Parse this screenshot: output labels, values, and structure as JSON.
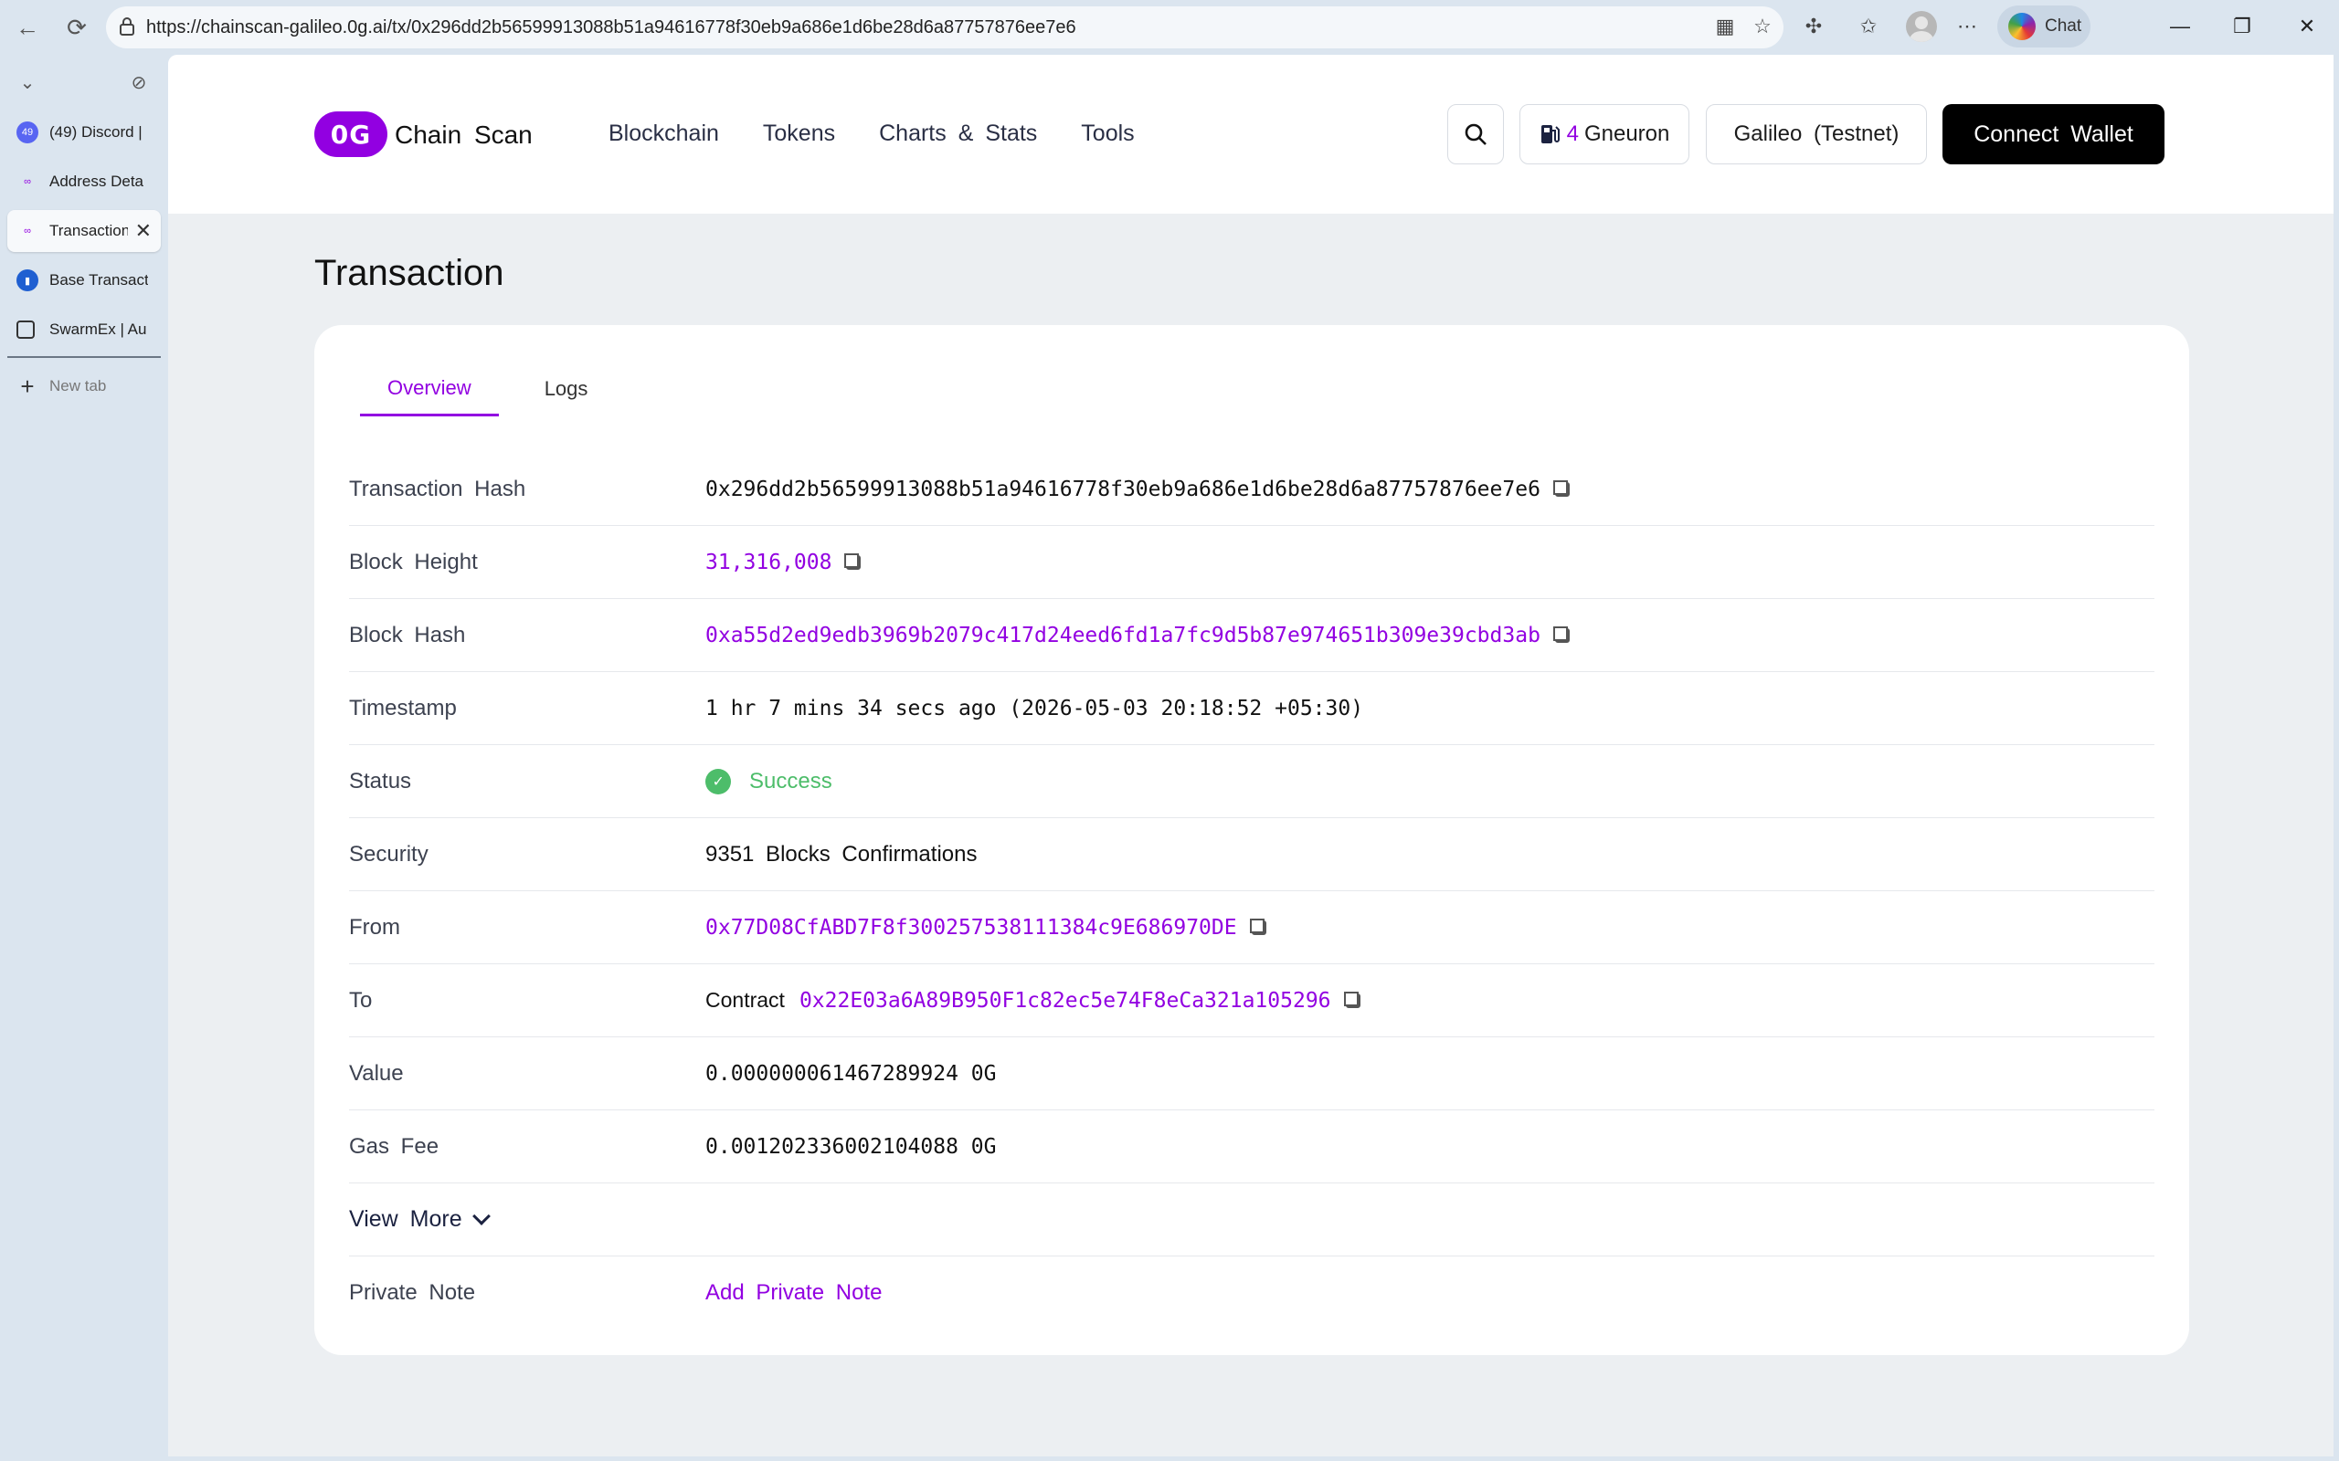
{
  "browser": {
    "url": "https://chainscan-galileo.0g.ai/tx/0x296dd2b56599913088b51a94616778f30eb9a686e1d6be28d6a87757876ee7e6",
    "chat_label": "Chat",
    "tabs": [
      {
        "label": "(49) Discord |",
        "badge": "49"
      },
      {
        "label": "Address Deta"
      },
      {
        "label": "Transaction"
      },
      {
        "label": "Base Transact"
      },
      {
        "label": "SwarmEx | Au"
      }
    ],
    "new_tab_label": "New tab"
  },
  "header": {
    "logo_mark": "0G",
    "logo_text": "Chain Scan",
    "nav": [
      "Blockchain",
      "Tokens",
      "Charts & Stats",
      "Tools"
    ],
    "gas_value": "4",
    "gas_unit": "Gneuron",
    "network": "Galileo (Testnet)",
    "connect_label": "Connect Wallet"
  },
  "page": {
    "title": "Transaction",
    "tabs": [
      "Overview",
      "Logs"
    ],
    "details": {
      "tx_hash_label": "Transaction Hash",
      "tx_hash": "0x296dd2b56599913088b51a94616778f30eb9a686e1d6be28d6a87757876ee7e6",
      "block_height_label": "Block Height",
      "block_height": "31,316,008",
      "block_hash_label": "Block Hash",
      "block_hash": "0xa55d2ed9edb3969b2079c417d24eed6fd1a7fc9d5b87e974651b309e39cbd3ab",
      "timestamp_label": "Timestamp",
      "timestamp": "1 hr 7 mins 34 secs ago (2026-05-03 20:18:52 +05:30)",
      "status_label": "Status",
      "status": "Success",
      "security_label": "Security",
      "security": "9351 Blocks Confirmations",
      "from_label": "From",
      "from": "0x77D08CfABD7F8f300257538111384c9E686970DE",
      "to_label": "To",
      "to_prefix": "Contract",
      "to": "0x22E03a6A89B950F1c82ec5e74F8eCa321a105296",
      "value_label": "Value",
      "value": "0.000000061467289924 0G",
      "gas_fee_label": "Gas Fee",
      "gas_fee": "0.001202336002104088 0G",
      "view_more": "View More",
      "private_note_label": "Private Note",
      "private_note_action": "Add Private Note"
    }
  },
  "colors": {
    "accent": "#9200e1",
    "success": "#4dbd6a",
    "page_bg": "#eceff2",
    "chrome_bg": "#dbe5ef"
  }
}
